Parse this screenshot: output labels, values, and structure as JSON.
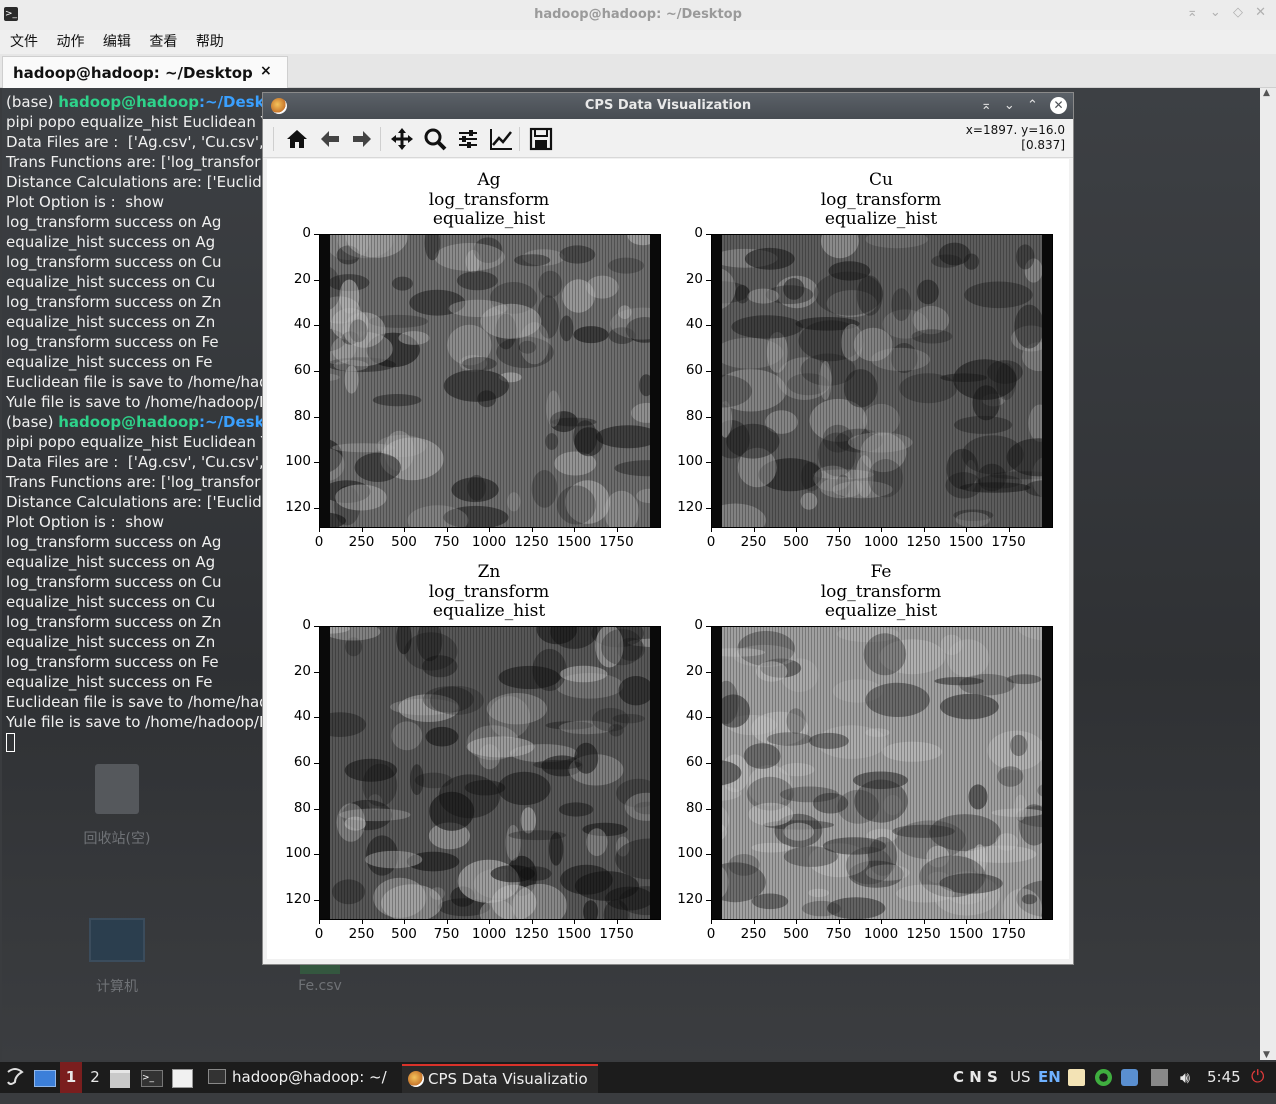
{
  "terminal_window": {
    "title": "hadoop@hadoop: ~/Desktop",
    "menu": [
      "文件",
      "动作",
      "编辑",
      "查看",
      "帮助"
    ],
    "tab_label": "hadoop@hadoop: ~/Desktop",
    "tab_close": "×",
    "window_controls": [
      "⌅",
      "⌄",
      "◇",
      "✕"
    ]
  },
  "terminal": {
    "prompt_prefix": "(base) ",
    "prompt_user": "hadoop@hadoop",
    "prompt_path": ":~/Deskto",
    "cmd": "pipi popo equalize_hist Euclidean Y",
    "lines": [
      "Data Files are :  ['Ag.csv', 'Cu.csv',",
      "Trans Functions are: ['log_transfor",
      "Distance Calculations are: ['Euclide",
      "Plot Option is :  show",
      "log_transform success on Ag",
      "equalize_hist success on Ag",
      "log_transform success on Cu",
      "equalize_hist success on Cu",
      "log_transform success on Zn",
      "equalize_hist success on Zn",
      "log_transform success on Fe",
      "equalize_hist success on Fe",
      "Euclidean file is save to /home/had",
      "Yule file is save to /home/hadoop/D"
    ]
  },
  "desktop": {
    "trash_label": "回收站(空)",
    "computer_label": "计算机",
    "file_label": "Fe.csv"
  },
  "plot_window": {
    "title": "CPS Data Visualization",
    "coord_line1": "x=1897. y=16.0",
    "coord_line2": "[0.837]",
    "toolbar": [
      "home-icon",
      "back-icon",
      "forward-icon",
      "pan-icon",
      "zoom-icon",
      "configure-subplots-icon",
      "edit-axis-icon",
      "save-icon"
    ]
  },
  "chart_data": [
    {
      "type": "heatmap",
      "title": "Ag\nlog_transform\nequalize_hist",
      "title_lines": [
        "Ag",
        "log_transform",
        "equalize_hist"
      ],
      "xticks": [
        "0",
        "250",
        "500",
        "750",
        "1000",
        "1250",
        "1500",
        "1750"
      ],
      "yticks": [
        "0",
        "20",
        "40",
        "60",
        "80",
        "100",
        "120"
      ],
      "xlim": [
        0,
        2000
      ],
      "ylim": [
        128,
        0
      ],
      "colormap": "gray"
    },
    {
      "type": "heatmap",
      "title": "Cu\nlog_transform\nequalize_hist",
      "title_lines": [
        "Cu",
        "log_transform",
        "equalize_hist"
      ],
      "xticks": [
        "0",
        "250",
        "500",
        "750",
        "1000",
        "1250",
        "1500",
        "1750"
      ],
      "yticks": [
        "0",
        "20",
        "40",
        "60",
        "80",
        "100",
        "120"
      ],
      "xlim": [
        0,
        2000
      ],
      "ylim": [
        128,
        0
      ],
      "colormap": "gray"
    },
    {
      "type": "heatmap",
      "title": "Zn\nlog_transform\nequalize_hist",
      "title_lines": [
        "Zn",
        "log_transform",
        "equalize_hist"
      ],
      "xticks": [
        "0",
        "250",
        "500",
        "750",
        "1000",
        "1250",
        "1500",
        "1750"
      ],
      "yticks": [
        "0",
        "20",
        "40",
        "60",
        "80",
        "100",
        "120"
      ],
      "xlim": [
        0,
        2000
      ],
      "ylim": [
        128,
        0
      ],
      "colormap": "gray"
    },
    {
      "type": "heatmap",
      "title": "Fe\nlog_transform\nequalize_hist",
      "title_lines": [
        "Fe",
        "log_transform",
        "equalize_hist"
      ],
      "xticks": [
        "0",
        "250",
        "500",
        "750",
        "1000",
        "1250",
        "1500",
        "1750"
      ],
      "yticks": [
        "0",
        "20",
        "40",
        "60",
        "80",
        "100",
        "120"
      ],
      "xlim": [
        0,
        2000
      ],
      "ylim": [
        128,
        0
      ],
      "colormap": "gray"
    }
  ],
  "taskbar": {
    "workspace_1": "1",
    "workspace_2": "2",
    "task_terminal": "hadoop@hadoop: ~/",
    "task_plot": "CPS Data Visualizatio",
    "tray_text": "C N S",
    "keyboard": "US",
    "lang": "EN",
    "clock": "5:45"
  }
}
